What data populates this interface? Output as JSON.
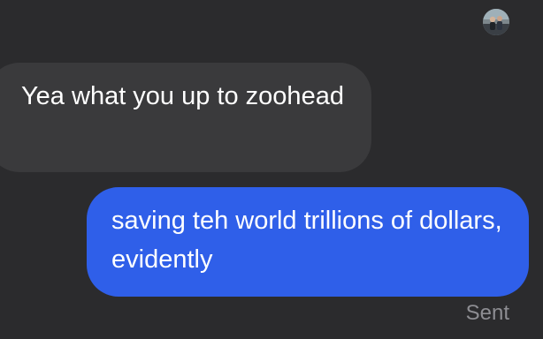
{
  "conversation": {
    "avatar_icon": "user-avatar-photo",
    "messages": [
      {
        "direction": "received",
        "text": "Yea what you up to zoohead"
      },
      {
        "direction": "sent",
        "text": "saving teh world trillions of dollars, evidently",
        "status": "Sent"
      }
    ]
  },
  "colors": {
    "background": "#2b2b2d",
    "received_bubble": "#3a3a3c",
    "sent_bubble": "#2f5fe9",
    "text": "#ffffff",
    "status_text": "#8d8d92"
  }
}
